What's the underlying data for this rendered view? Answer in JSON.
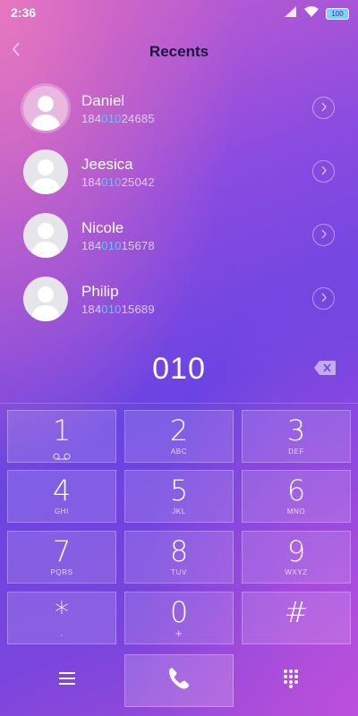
{
  "status_bar": {
    "time": "2:36",
    "battery": "100",
    "battery_color": "#7fd0ff"
  },
  "header": {
    "title": "Recents",
    "back_icon": "chevron-left-icon"
  },
  "query": "010",
  "contacts": [
    {
      "name": "Daniel",
      "number_prefix": "184",
      "number_match": "010",
      "number_suffix": "24685"
    },
    {
      "name": "Jeesica",
      "number_prefix": "184",
      "number_match": "010",
      "number_suffix": "25042"
    },
    {
      "name": "Nicole",
      "number_prefix": "184",
      "number_match": "010",
      "number_suffix": "15678"
    },
    {
      "name": "Philip",
      "number_prefix": "184",
      "number_match": "010",
      "number_suffix": "15689"
    }
  ],
  "dialer": {
    "dialed_number": "010",
    "backspace_icon": "backspace-icon"
  },
  "keypad": [
    {
      "digit": "1",
      "sub": "",
      "sub_icon": "voicemail-icon"
    },
    {
      "digit": "2",
      "sub": "ABC"
    },
    {
      "digit": "3",
      "sub": "DEF"
    },
    {
      "digit": "4",
      "sub": "GHI"
    },
    {
      "digit": "5",
      "sub": "JKL"
    },
    {
      "digit": "6",
      "sub": "MNO"
    },
    {
      "digit": "7",
      "sub": "PQRS"
    },
    {
      "digit": "8",
      "sub": "TUV"
    },
    {
      "digit": "9",
      "sub": "WXYZ"
    },
    {
      "digit": "*",
      "sub": ","
    },
    {
      "digit": "0",
      "sub": "+"
    },
    {
      "digit": "#",
      "sub": ""
    }
  ],
  "bottom_bar": {
    "menu_icon": "menu-icon",
    "call_icon": "phone-icon",
    "keypad_icon": "dialpad-icon"
  },
  "colors": {
    "match_highlight": "#63c3ff",
    "title": "#1c1640"
  }
}
